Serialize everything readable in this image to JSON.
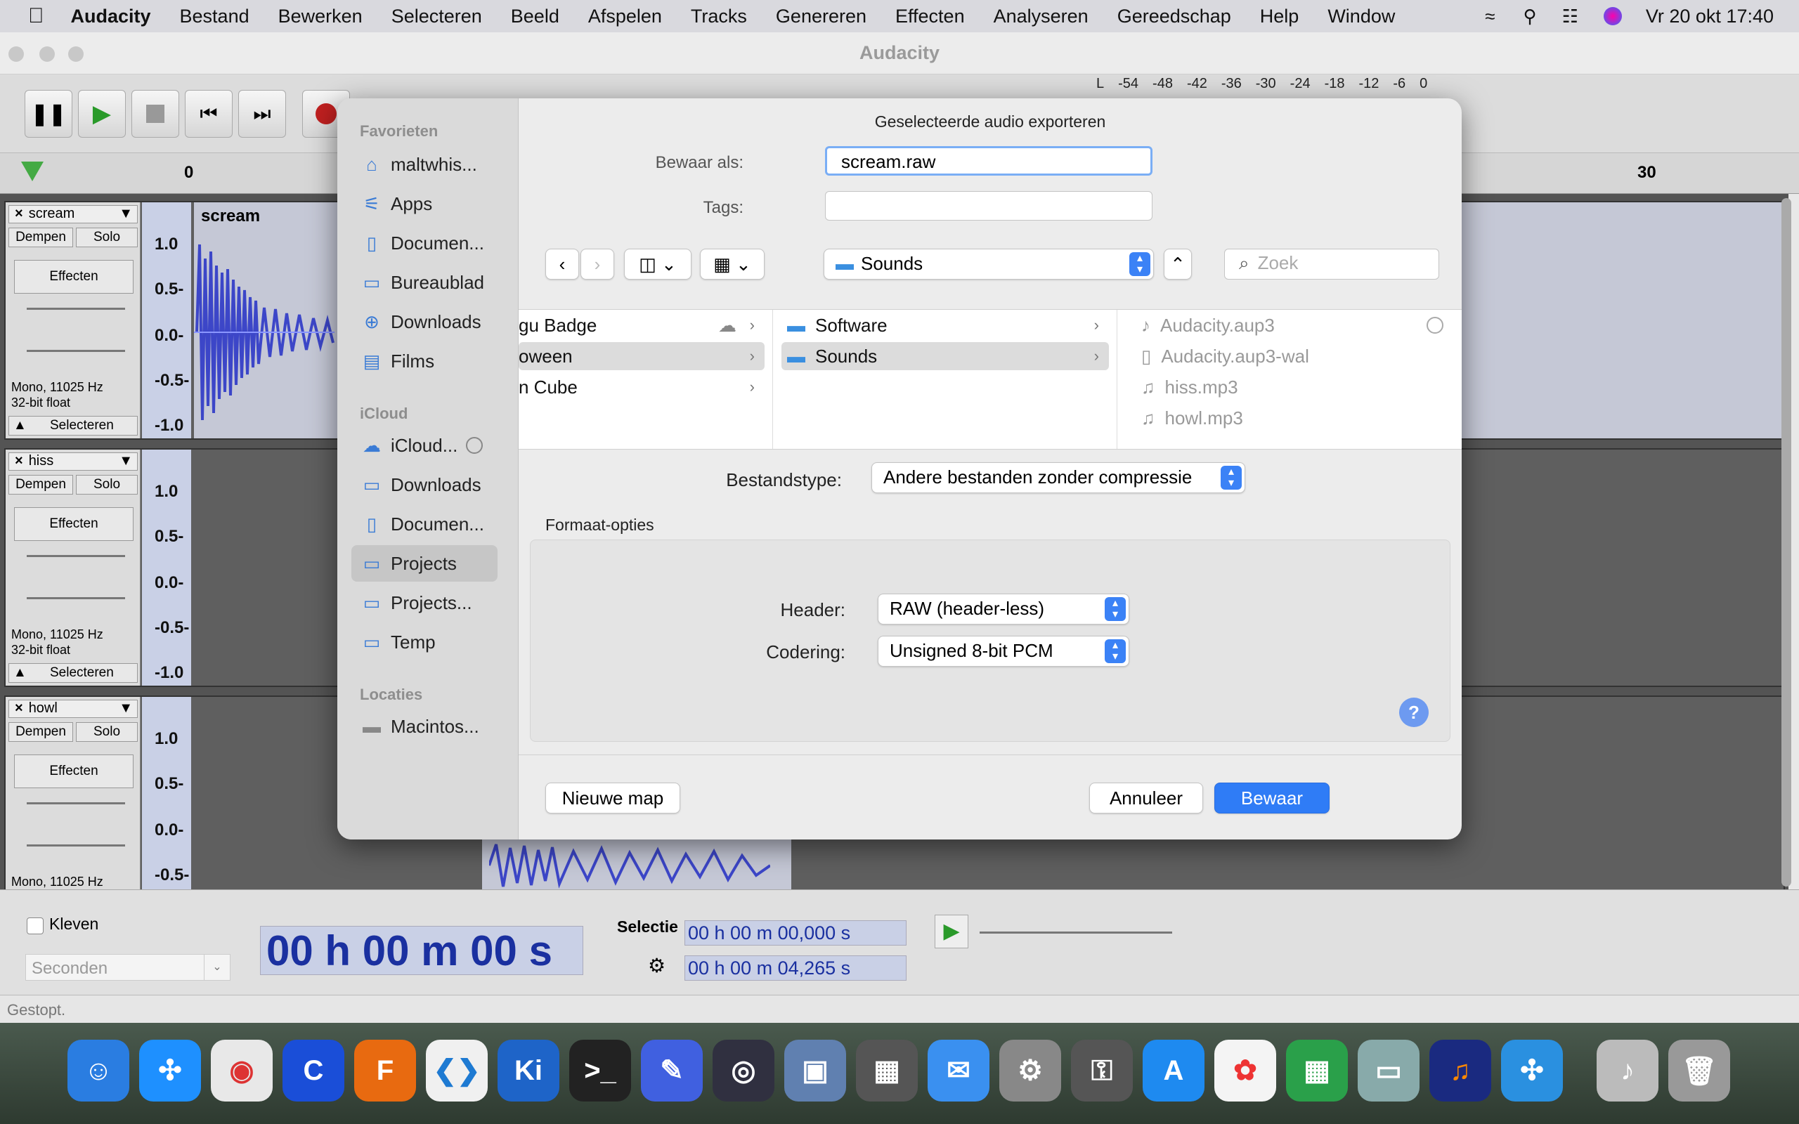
{
  "menubar": {
    "items": [
      "Audacity",
      "Bestand",
      "Bewerken",
      "Selecteren",
      "Beeld",
      "Afspelen",
      "Tracks",
      "Genereren",
      "Effecten",
      "Analyseren",
      "Gereedschap",
      "Help",
      "Window"
    ],
    "clock": "Vr 20 okt  17:40"
  },
  "window": {
    "title": "Audacity"
  },
  "meter": {
    "ticks": [
      "-54",
      "-48",
      "-42",
      "-36",
      "-30",
      "-24",
      "-18",
      "-12",
      "-6",
      "0"
    ],
    "channel": "L"
  },
  "ruler": {
    "ticks": [
      "0",
      "30"
    ]
  },
  "tracks": [
    {
      "name": "scream",
      "mute": "Dempen",
      "solo": "Solo",
      "effects": "Effecten",
      "info1": "Mono, 11025 Hz",
      "info2": "32-bit float",
      "select": "Selecteren",
      "clip": "scream",
      "scale": [
        "1.0",
        "0.5-",
        "0.0-",
        "-0.5-",
        "-1.0"
      ]
    },
    {
      "name": "hiss",
      "mute": "Dempen",
      "solo": "Solo",
      "effects": "Effecten",
      "info1": "Mono, 11025 Hz",
      "info2": "32-bit float",
      "select": "Selecteren",
      "scale": [
        "1.0",
        "0.5-",
        "0.0-",
        "-0.5-",
        "-1.0"
      ]
    },
    {
      "name": "howl",
      "mute": "Dempen",
      "solo": "Solo",
      "effects": "Effecten",
      "info1": "Mono, 11025 Hz",
      "scale": [
        "1.0",
        "0.5-",
        "0.0-",
        "-0.5-"
      ]
    }
  ],
  "bottom": {
    "snap": "Kleven",
    "seconds": "Seconden",
    "time": "00 h 00 m 00 s",
    "selection_label": "Selectie",
    "sel_start": "00 h 00 m 00,000 s",
    "sel_end": "00 h 00 m 04,265 s"
  },
  "status": "Gestopt.",
  "dialog": {
    "title": "Geselecteerde audio exporteren",
    "save_as_label": "Bewaar als:",
    "filename": "scream.raw",
    "tags_label": "Tags:",
    "location": "Sounds",
    "search_placeholder": "Zoek",
    "sidebar": {
      "favorites_head": "Favorieten",
      "favorites": [
        {
          "label": "maltwhis...",
          "icon": "home-icon"
        },
        {
          "label": "Apps",
          "icon": "apps-icon"
        },
        {
          "label": "Documen...",
          "icon": "document-icon"
        },
        {
          "label": "Bureaublad",
          "icon": "desktop-icon"
        },
        {
          "label": "Downloads",
          "icon": "download-icon"
        },
        {
          "label": "Films",
          "icon": "film-icon"
        }
      ],
      "icloud_head": "iCloud",
      "icloud": [
        {
          "label": "iCloud...",
          "icon": "cloud-icon"
        },
        {
          "label": "Downloads",
          "icon": "folder-icon"
        },
        {
          "label": "Documen...",
          "icon": "document-icon"
        },
        {
          "label": "Projects",
          "icon": "folder-icon"
        },
        {
          "label": "Projects...",
          "icon": "folder-icon"
        },
        {
          "label": "Temp",
          "icon": "folder-icon"
        }
      ],
      "locations_head": "Locaties",
      "locations": [
        {
          "label": "Macintos...",
          "icon": "disk-icon"
        }
      ]
    },
    "columns": {
      "col1": [
        "gu Badge",
        "oween",
        "n Cube"
      ],
      "col2": [
        "Software",
        "Sounds"
      ],
      "col3": [
        "Audacity.aup3",
        "Audacity.aup3-wal",
        "hiss.mp3",
        "howl.mp3"
      ]
    },
    "filetype_label": "Bestandstype:",
    "filetype": "Andere bestanden zonder compressie",
    "format_options": "Formaat-opties",
    "header_label": "Header:",
    "header": "RAW (header-less)",
    "encoding_label": "Codering:",
    "encoding": "Unsigned 8-bit PCM",
    "help": "?",
    "new_folder": "Nieuwe map",
    "cancel": "Annuleer",
    "save": "Bewaar"
  },
  "colors": {
    "accent": "#3b82f6",
    "waveform": "#3c46c8"
  }
}
